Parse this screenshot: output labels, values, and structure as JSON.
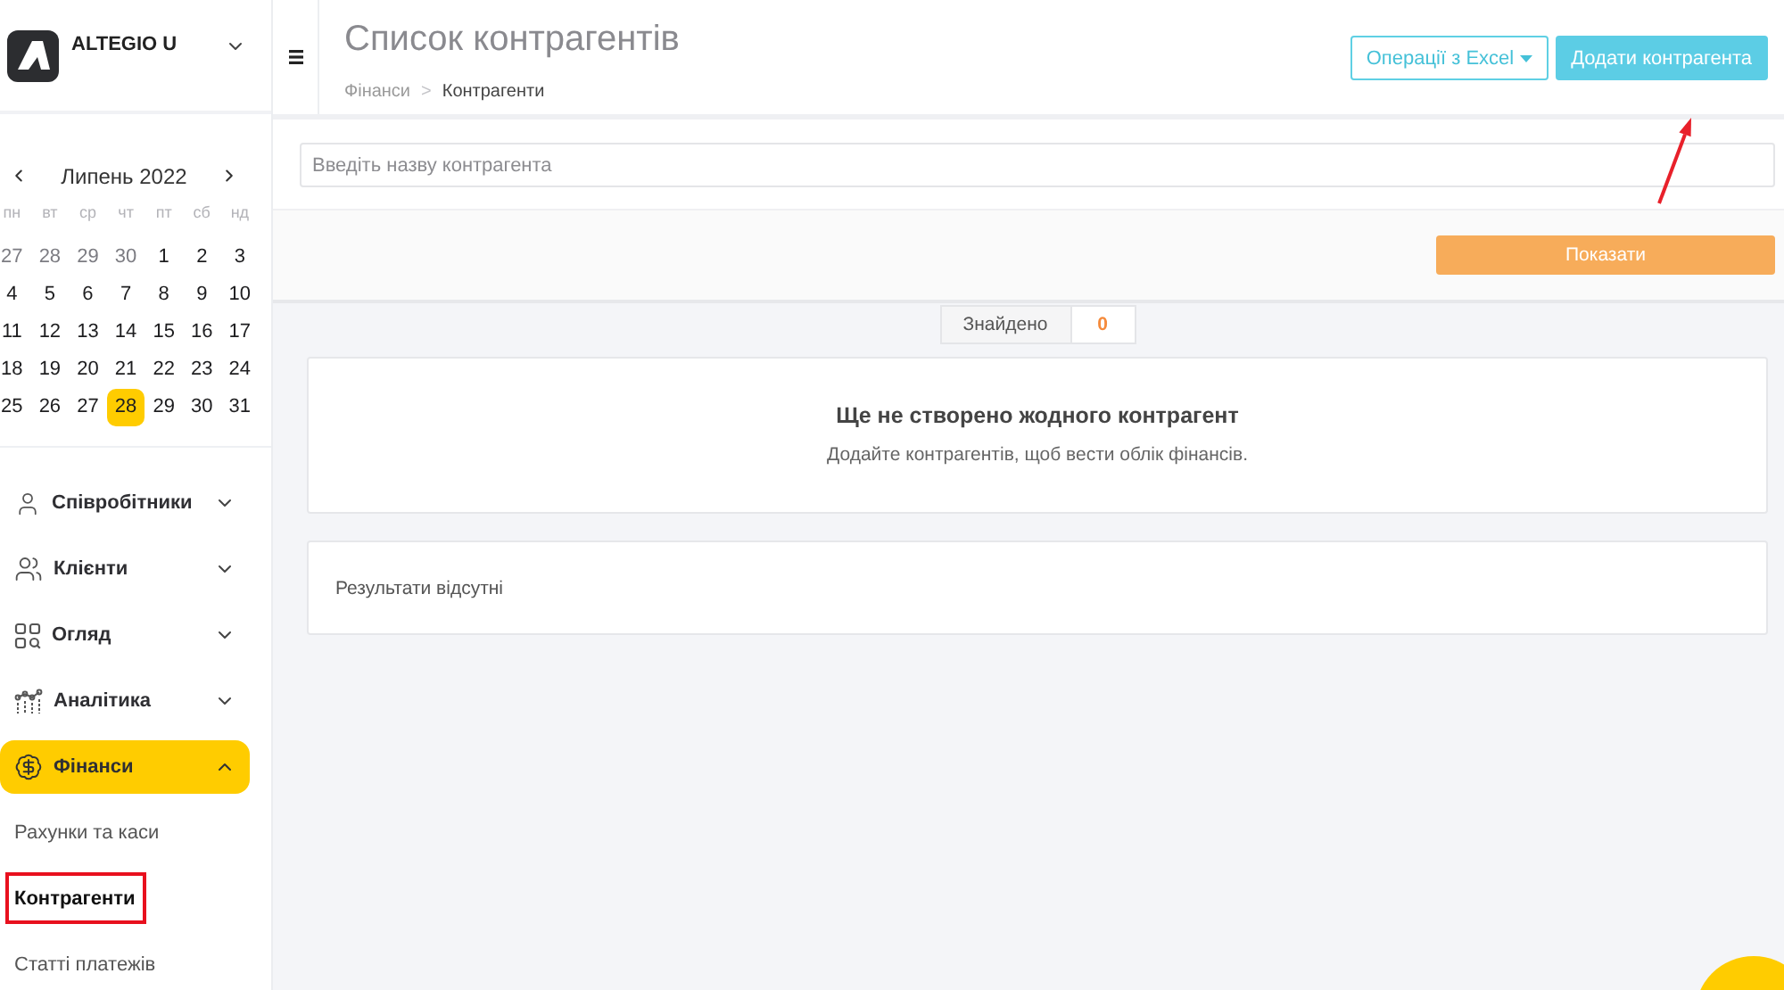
{
  "sidebar": {
    "company": {
      "name": "ALTEGIO U"
    },
    "calendar": {
      "month": "Липень 2022",
      "weekdays": [
        "пн",
        "вт",
        "ср",
        "чт",
        "пт",
        "сб",
        "нд"
      ],
      "weeks": [
        [
          {
            "day": "27",
            "other_month": true,
            "selected": false
          },
          {
            "day": "28",
            "other_month": true,
            "selected": false
          },
          {
            "day": "29",
            "other_month": true,
            "selected": false
          },
          {
            "day": "30",
            "other_month": true,
            "selected": false
          },
          {
            "day": "1",
            "other_month": false,
            "selected": false
          },
          {
            "day": "2",
            "other_month": false,
            "selected": false
          },
          {
            "day": "3",
            "other_month": false,
            "selected": false
          }
        ],
        [
          {
            "day": "4",
            "other_month": false,
            "selected": false
          },
          {
            "day": "5",
            "other_month": false,
            "selected": false
          },
          {
            "day": "6",
            "other_month": false,
            "selected": false
          },
          {
            "day": "7",
            "other_month": false,
            "selected": false
          },
          {
            "day": "8",
            "other_month": false,
            "selected": false
          },
          {
            "day": "9",
            "other_month": false,
            "selected": false
          },
          {
            "day": "10",
            "other_month": false,
            "selected": false
          }
        ],
        [
          {
            "day": "11",
            "other_month": false,
            "selected": false
          },
          {
            "day": "12",
            "other_month": false,
            "selected": false
          },
          {
            "day": "13",
            "other_month": false,
            "selected": false
          },
          {
            "day": "14",
            "other_month": false,
            "selected": false
          },
          {
            "day": "15",
            "other_month": false,
            "selected": false
          },
          {
            "day": "16",
            "other_month": false,
            "selected": false
          },
          {
            "day": "17",
            "other_month": false,
            "selected": false
          }
        ],
        [
          {
            "day": "18",
            "other_month": false,
            "selected": false
          },
          {
            "day": "19",
            "other_month": false,
            "selected": false
          },
          {
            "day": "20",
            "other_month": false,
            "selected": false
          },
          {
            "day": "21",
            "other_month": false,
            "selected": false
          },
          {
            "day": "22",
            "other_month": false,
            "selected": false
          },
          {
            "day": "23",
            "other_month": false,
            "selected": false
          },
          {
            "day": "24",
            "other_month": false,
            "selected": false
          }
        ],
        [
          {
            "day": "25",
            "other_month": false,
            "selected": false
          },
          {
            "day": "26",
            "other_month": false,
            "selected": false
          },
          {
            "day": "27",
            "other_month": false,
            "selected": false
          },
          {
            "day": "28",
            "other_month": false,
            "selected": true
          },
          {
            "day": "29",
            "other_month": false,
            "selected": false
          },
          {
            "day": "30",
            "other_month": false,
            "selected": false
          },
          {
            "day": "31",
            "other_month": false,
            "selected": false
          }
        ]
      ]
    },
    "menu": [
      {
        "label": "Співробітники",
        "selected": false,
        "expanded": false
      },
      {
        "label": "Клієнти",
        "selected": false,
        "expanded": false
      },
      {
        "label": "Огляд",
        "selected": false,
        "expanded": false
      },
      {
        "label": "Аналітика",
        "selected": false,
        "expanded": false
      },
      {
        "label": "Фінанси",
        "selected": true,
        "expanded": true,
        "children": [
          {
            "label": "Рахунки та каси",
            "selected": false,
            "highlighted": false
          },
          {
            "label": "Контрагенти",
            "selected": true,
            "highlighted": true
          },
          {
            "label": "Статті платежів",
            "selected": false,
            "highlighted": false
          }
        ]
      }
    ]
  },
  "header": {
    "title": "Список контрагентів",
    "breadcrumb_separator": ">",
    "breadcrumbs": [
      {
        "label": "Фінанси",
        "current": false
      },
      {
        "label": "Контрагенти",
        "current": true
      }
    ],
    "buttons": [
      {
        "kind": "outline",
        "label": "Операції з Excel",
        "dropdown": true,
        "pointed": false
      },
      {
        "kind": "filled",
        "label": "Додати контрагента",
        "dropdown": false,
        "pointed": true
      }
    ]
  },
  "filter": {
    "search": {
      "placeholder": "Введіть назву контрагента"
    },
    "submit": "Показати"
  },
  "results": {
    "found_label": "Знайдено",
    "found_count": "0",
    "empty_state": {
      "title": "Ще не створено жодного контрагент",
      "text": "Додайте контрагентів, щоб вести облік фінансів."
    },
    "message": "Результати відсутні"
  }
}
